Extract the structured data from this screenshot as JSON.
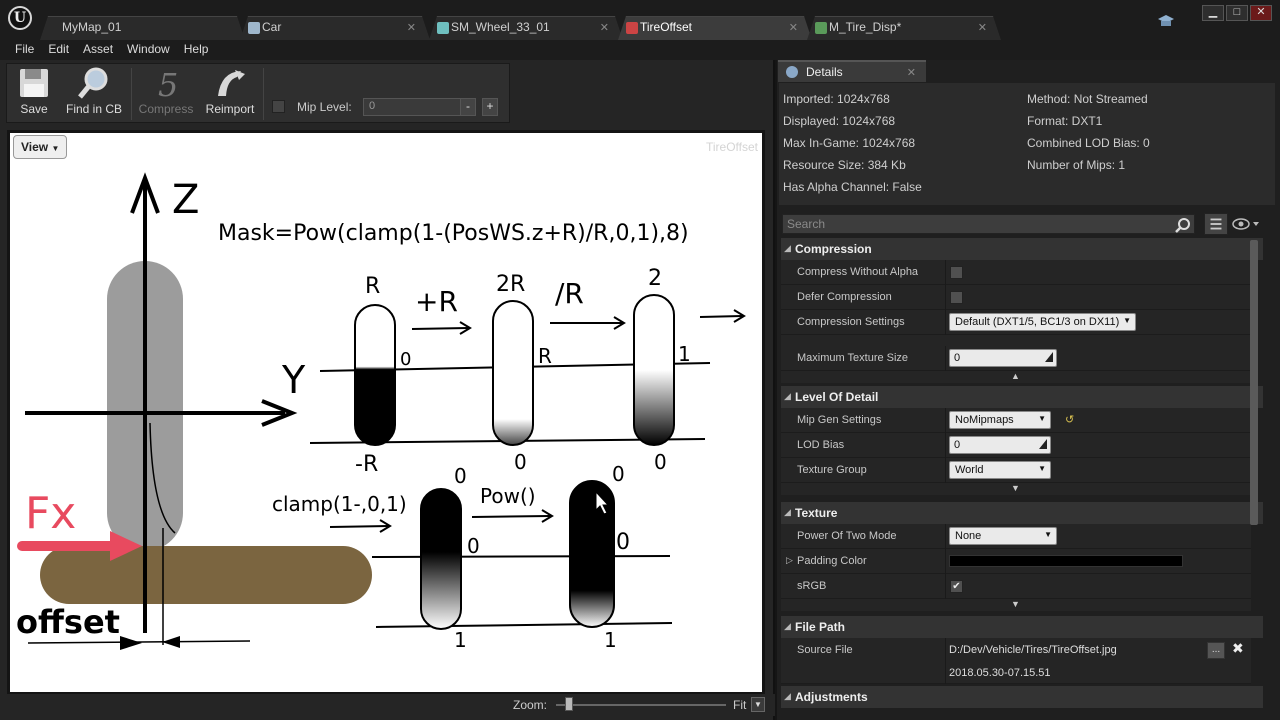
{
  "titlebar": {
    "tabs": [
      {
        "label": "MyMap_01"
      },
      {
        "label": "Car"
      },
      {
        "label": "SM_Wheel_33_01"
      },
      {
        "label": "TireOffset"
      },
      {
        "label": "M_Tire_Disp*"
      }
    ],
    "close_glyph": "✕"
  },
  "menu": [
    "File",
    "Edit",
    "Asset",
    "Window",
    "Help"
  ],
  "toolbar": {
    "save": "Save",
    "find_in_cb": "Find in CB",
    "compress": "Compress",
    "reimport": "Reimport",
    "mip_level_label": "Mip Level:",
    "mip_level_value": "0",
    "minus": "-",
    "plus": "+"
  },
  "viewport": {
    "view_button": "View",
    "watermark": "TireOffset",
    "zoom_label": "Zoom:",
    "zoom_value": "Fit"
  },
  "diagram_text": {
    "formula": "Mask=Pow(clamp(1-(PosWS.z+R)/R,0,1),8)",
    "axis_z": "Z",
    "axis_y": "Y",
    "force": "Fx",
    "offset": "offset",
    "plus_r": "+R",
    "div_r": "/R",
    "clamp_label": "clamp(1-,0,1)",
    "pow_label": "Pow()",
    "cap1_top": "R",
    "cap1_mid": "0",
    "cap1_bottom": "-R",
    "cap2_top": "2R",
    "cap2_mid": "R",
    "cap2_bottom": "0",
    "cap3_top": "2",
    "cap3_mid": "1",
    "cap3_bottom": "0",
    "cap4_top": "0",
    "cap4_mid": "0",
    "cap4_bottom": "1",
    "cap5_top": "0",
    "cap5_mid": "0",
    "cap5_bottom": "1"
  },
  "details": {
    "tab_label": "Details",
    "info_left": [
      "Imported: 1024x768",
      "Displayed: 1024x768",
      "Max In-Game: 1024x768",
      "Resource Size: 384 Kb",
      "Has Alpha Channel: False"
    ],
    "info_right": [
      "Method: Not Streamed",
      "Format: DXT1",
      "Combined LOD Bias: 0",
      "Number of Mips: 1"
    ],
    "search_placeholder": "Search",
    "categories": {
      "compression": "Compression",
      "lod": "Level Of Detail",
      "texture": "Texture",
      "file_path": "File Path",
      "adjustments": "Adjustments"
    },
    "compression": {
      "compress_without_alpha": "Compress Without Alpha",
      "defer_compression": "Defer Compression",
      "compression_settings": "Compression Settings",
      "compression_settings_value": "Default (DXT1/5, BC1/3 on DX11)",
      "max_texture_size": "Maximum Texture Size",
      "max_texture_size_value": "0"
    },
    "lod": {
      "mip_gen_settings": "Mip Gen Settings",
      "mip_gen_settings_value": "NoMipmaps",
      "lod_bias": "LOD Bias",
      "lod_bias_value": "0",
      "texture_group": "Texture Group",
      "texture_group_value": "World"
    },
    "texture": {
      "power_of_two_mode": "Power Of Two Mode",
      "power_of_two_mode_value": "None",
      "padding_color": "Padding Color",
      "srgb": "sRGB",
      "srgb_checked": "✔"
    },
    "file_path": {
      "source_file": "Source File",
      "source_file_value": "D:/Dev/Vehicle/Tires/TireOffset.jpg",
      "source_file_date": "2018.05.30-07.15.51",
      "browse": "..."
    }
  }
}
